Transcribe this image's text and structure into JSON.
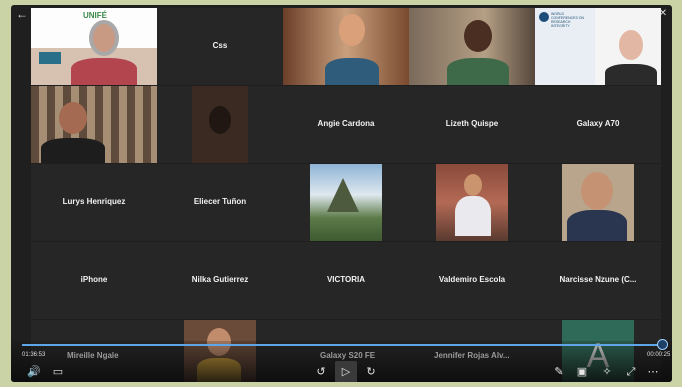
{
  "window": {
    "back_icon": "arrow-left-icon",
    "controls": [
      "—",
      "◻",
      "✕"
    ]
  },
  "tiles": {
    "c": "Css",
    "angie": "Angie Cardona",
    "lizeth": "Lizeth Quispe",
    "galaxy_a70": "Galaxy A70",
    "lurys": "Lurys Henriquez",
    "eliecer": "Eliecer Tuñon",
    "iphone": "iPhone",
    "nilka": "Nilka Gutierrez",
    "victoria": "VICTORIA",
    "valdemiro": "Valdemiro Escola",
    "narcisse": "Narcisse Nzune (C...",
    "mireille": "Mireille Ngale",
    "galaxy_s20": "Galaxy S20 FE",
    "jennifer": "Jennifer Rojas Alv...",
    "avatar_letter": "A"
  },
  "unife_logo": "UNIFÉ",
  "conference_text": "WORLD CONFERENCES ON RESEARCH INTEGRITY",
  "player": {
    "current_time": "01:36:53",
    "end_time": "00:00:25",
    "progress": 0.985
  }
}
